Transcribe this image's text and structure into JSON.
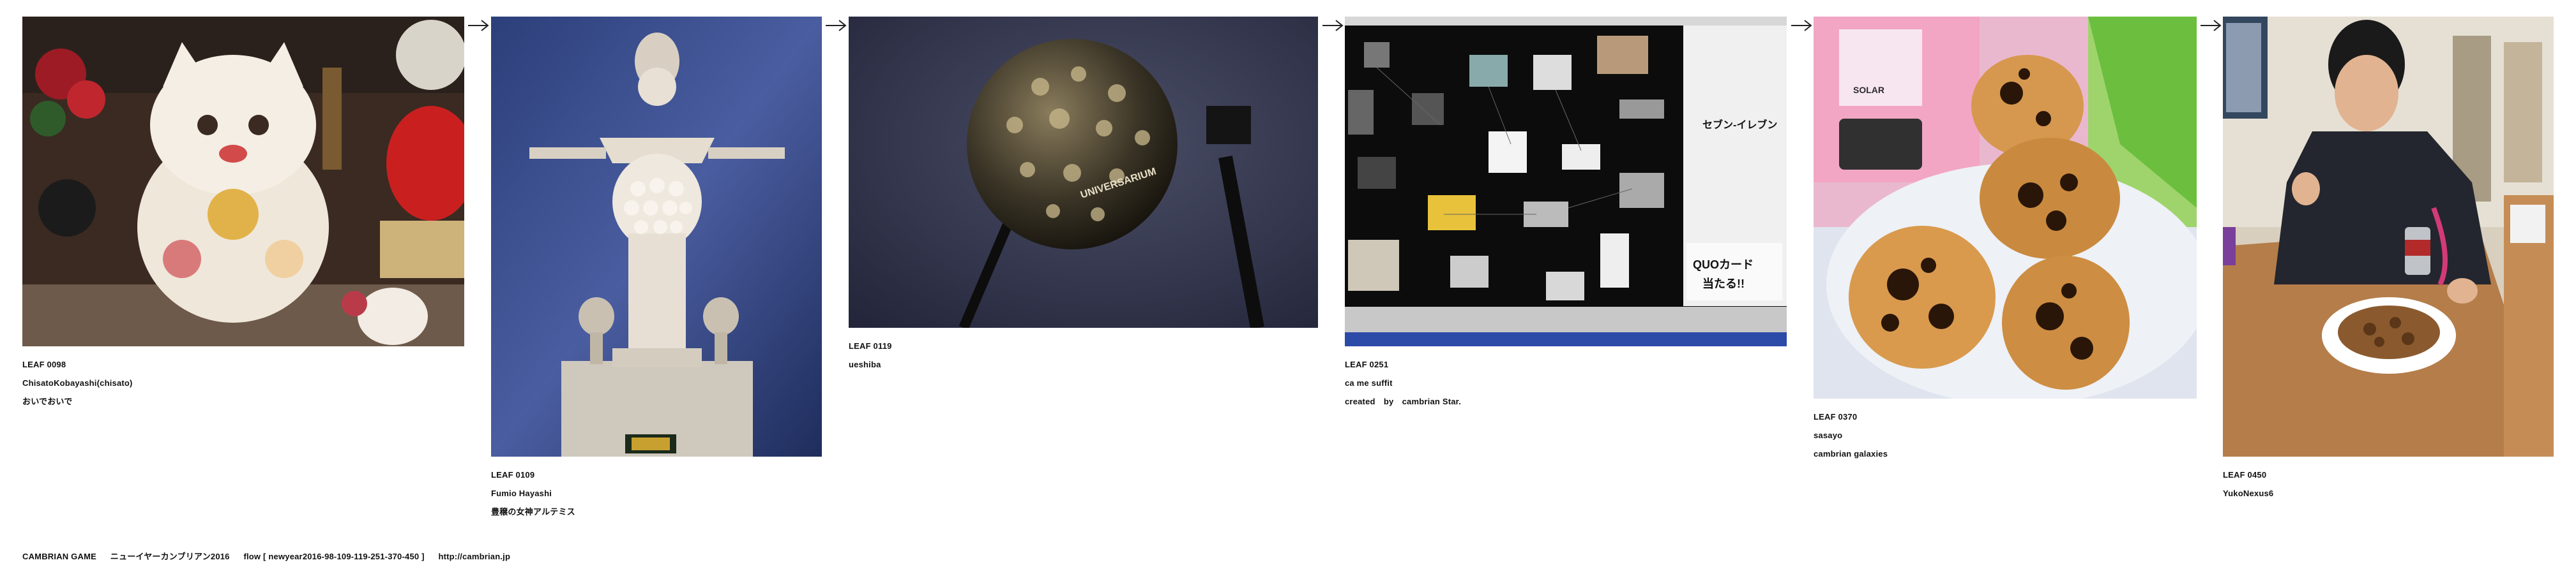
{
  "leaves": [
    {
      "id": "LEAF 0098",
      "author": "ChisatoKobayashi(chisato)",
      "note": "おいでおいで"
    },
    {
      "id": "LEAF 0109",
      "author": "Fumio Hayashi",
      "note": "豊穣の女神アルテミス"
    },
    {
      "id": "LEAF 0119",
      "author": "ueshiba",
      "note": ""
    },
    {
      "id": "LEAF 0251",
      "author": "ca me suffit",
      "note": "created　by　cambrian Star."
    },
    {
      "id": "LEAF 0370",
      "author": "sasayo",
      "note": "cambrian galaxies"
    },
    {
      "id": "LEAF 0450",
      "author": "YukoNexus6",
      "note": ""
    }
  ],
  "photo_texts": {
    "planetarium": "UNIVERSARIUM",
    "screen_title": "セブン-イレブン",
    "screen_card": "QUOカード",
    "screen_card2": "当たる!!",
    "sticker": "SOLAR"
  },
  "footer": {
    "game": "CAMBRIAN GAME",
    "event": "ニューイヤーカンブリアン2016",
    "flow": "flow [ newyear2016-98-109-119-251-370-450 ]",
    "url": "http://cambrian.jp"
  },
  "icons": [
    "arrow-right-icon"
  ]
}
